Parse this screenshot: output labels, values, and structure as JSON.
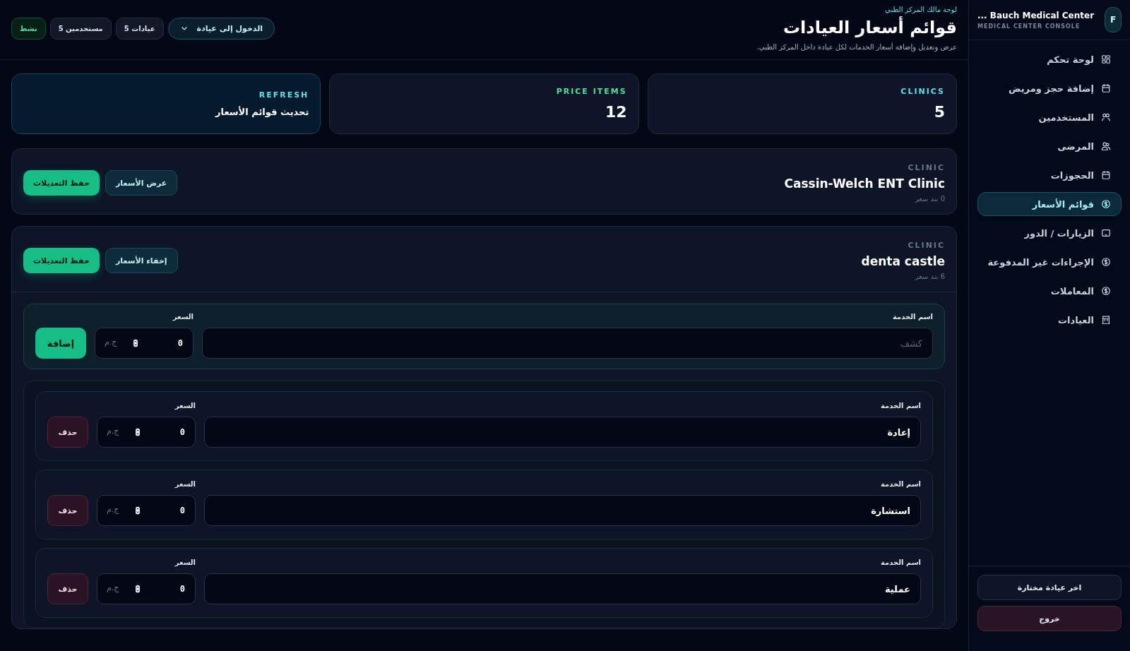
{
  "sidebar": {
    "avatar": "F",
    "title": "Bauch Medical Center ...",
    "subtitle": "MEDICAL CENTER CONSOLE",
    "items": [
      {
        "label": "لوحة تحكم",
        "selected": false
      },
      {
        "label": "إضافة حجز ومريض",
        "selected": false
      },
      {
        "label": "المستخدمين",
        "selected": false
      },
      {
        "label": "المرضى",
        "selected": false
      },
      {
        "label": "الحجوزات",
        "selected": false
      },
      {
        "label": "قوائم الأسعار",
        "selected": true
      },
      {
        "label": "الزيارات / الدور",
        "selected": false
      },
      {
        "label": "الإجراءات غير المدفوعة",
        "selected": false
      },
      {
        "label": "المعاملات",
        "selected": false
      },
      {
        "label": "العيادات",
        "selected": false
      }
    ],
    "footer_buttons": [
      {
        "label": "اخر عيادة مختارة",
        "kind": "neutral"
      },
      {
        "label": "خروج",
        "kind": "danger"
      }
    ]
  },
  "header": {
    "eyebrow": "لوحة مالك المركز الطبي",
    "title": "قوائم أسعار العيادات",
    "subtitle": "عرض وتعديل وإضافة أسعار الخدمات لكل عيادة داخل المركز الطبي."
  },
  "top_controls": {
    "clinic_switch": "الدخول إلى عيادة",
    "badges": [
      {
        "text": "عيادات 5",
        "kind": "neutral"
      },
      {
        "text": "مستخدمين 5",
        "kind": "neutral"
      },
      {
        "text": "نشط",
        "kind": "status"
      }
    ]
  },
  "stats": [
    {
      "label": "CLINICS",
      "value": "5",
      "kind": "stat",
      "color": "#5ee0ea"
    },
    {
      "label": "PRICE ITEMS",
      "value": "12",
      "kind": "stat",
      "color": "#4ee0a0"
    },
    {
      "label": "REFRESH",
      "value": "تحديث قوائم الأسعار",
      "kind": "action",
      "color": "#5ee0ea"
    }
  ],
  "clinics": [
    {
      "eyebrow": "CLINIC",
      "name": "Cassin-Welch ENT Clinic",
      "count": "0 بند سعر",
      "toggle_button": "عرض الأسعار",
      "save_button": "حفظ التعديلات",
      "expanded": false
    },
    {
      "eyebrow": "CLINIC",
      "name": "denta castle",
      "count": "6 بند سعر",
      "toggle_button": "إخفاء الأسعار",
      "save_button": "حفظ التعديلات",
      "expanded": true,
      "new_item": {
        "name_label": "اسم الخدمة",
        "name_placeholder": "كشف",
        "price_label": "السعر",
        "price": "0",
        "currency": "ج.م",
        "add_button": "إضافة"
      },
      "items": [
        {
          "name_label": "اسم الخدمة",
          "name": "إعادة",
          "price_label": "السعر",
          "price": "0",
          "currency": "ج.م",
          "delete_button": "حذف"
        },
        {
          "name_label": "اسم الخدمة",
          "name": "استشارة",
          "price_label": "السعر",
          "price": "0",
          "currency": "ج.م",
          "delete_button": "حذف"
        },
        {
          "name_label": "اسم الخدمة",
          "name": "عملية",
          "price_label": "السعر",
          "price": "0",
          "currency": "ج.م",
          "delete_button": "حذف"
        }
      ]
    }
  ]
}
